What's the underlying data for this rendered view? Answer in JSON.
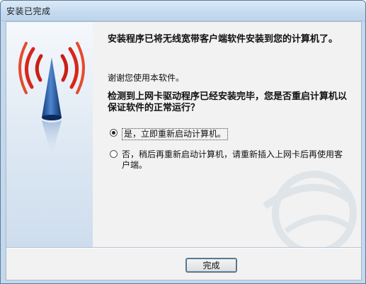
{
  "window": {
    "title": "安装已完成"
  },
  "main": {
    "heading": "安装程序已将无线宽带客户端软件安装到您的计算机了。",
    "thanks": "谢谢您使用本软件。",
    "question": "检测到上网卡驱动程序已经安装完毕，您是否重启计算机以保证软件的正常运行？",
    "options": [
      {
        "label": "是，立即重新启动计算机。",
        "selected": true
      },
      {
        "label": "否，稍后再重新启动计算机，请重新插入上网卡后再使用客户端。",
        "selected": false
      }
    ]
  },
  "footer": {
    "finish_label": "完成"
  },
  "colors": {
    "accent_red": "#d8261b",
    "antenna_blue": "#1c4f9c",
    "focus_blue": "#3c7fb1"
  },
  "icons": [
    "antenna-icon",
    "watermark-icon"
  ]
}
